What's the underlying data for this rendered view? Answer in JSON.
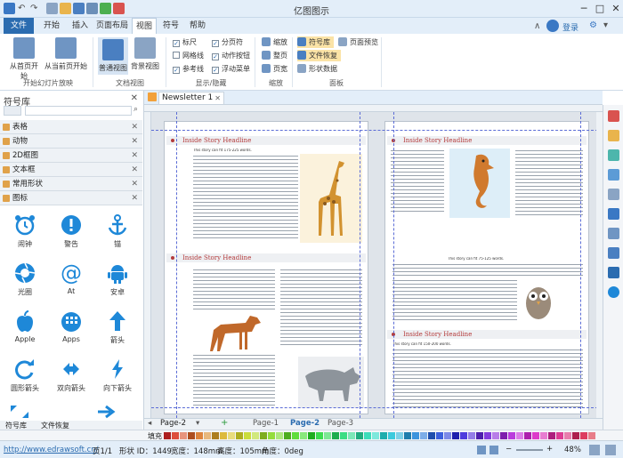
{
  "app_title": "亿图图示",
  "tabs": [
    "文件",
    "开始",
    "插入",
    "页面布局",
    "视图",
    "符号",
    "帮助"
  ],
  "active_tab": "视图",
  "top_right": {
    "login": "登录"
  },
  "ribbon": {
    "slideshow": {
      "from_start": "从首页开始",
      "from_current": "从当前页开始",
      "group": "开始幻灯片放映"
    },
    "docview": {
      "normal": "普通视图",
      "background": "背景视图",
      "group": "文档视图"
    },
    "show": {
      "ruler": "标尺",
      "pagebreak": "分页符",
      "grid": "网格线",
      "action": "动作按钮",
      "refline": "参考线",
      "float": "浮动菜单",
      "group": "显示/隐藏"
    },
    "zoom": {
      "zoom": "缩放",
      "page": "整页",
      "width": "页宽",
      "group": "缩放"
    },
    "panels": {
      "library": "符号库",
      "preview": "页面预览",
      "recover": "文件恢复",
      "shapedata": "形状数据",
      "group": "面板"
    }
  },
  "left_panel": {
    "title": "符号库",
    "categories": [
      "表格",
      "动物",
      "2D框图",
      "文本框",
      "常用形状",
      "图标"
    ],
    "shapes": [
      {
        "label": "闹钟",
        "icon": "alarm-clock-icon"
      },
      {
        "label": "警告",
        "icon": "warning-icon"
      },
      {
        "label": "锚",
        "icon": "anchor-icon"
      },
      {
        "label": "光圈",
        "icon": "aperture-icon"
      },
      {
        "label": "At",
        "icon": "at-sign-icon"
      },
      {
        "label": "安卓",
        "icon": "android-icon"
      },
      {
        "label": "Apple",
        "icon": "apple-icon"
      },
      {
        "label": "Apps",
        "icon": "apps-icon"
      },
      {
        "label": "箭头",
        "icon": "arrow-up-icon"
      },
      {
        "label": "圆形箭头",
        "icon": "circular-arrow-icon"
      },
      {
        "label": "双向箭头",
        "icon": "double-arrow-icon"
      },
      {
        "label": "向下箭头",
        "icon": "arrow-down-icon"
      }
    ],
    "bottom_tabs": [
      "符号库",
      "文件恢复"
    ]
  },
  "doc_tab": "Newsletter 1",
  "newsletter": {
    "headline": "Inside Story Headline",
    "subhead": "This story can fit 175-225 words.",
    "subhead2": "This story can fit 75-125 words.",
    "subhead3": "This story can fit 150-200 words."
  },
  "page_tabs": {
    "left": "Page-2",
    "tabs": [
      "Page-1",
      "Page-2",
      "Page-3"
    ],
    "active": "Page-2"
  },
  "palette_label": "填充",
  "status": {
    "url": "http://www.edrawsoft.cn/",
    "page": "页1/1",
    "shape_id": "形状 ID：1449",
    "width": "宽度：148mm",
    "height": "高度：105mm",
    "angle": "角度：0deg",
    "zoom": "48%"
  },
  "colors": {
    "accent": "#2b6cb0",
    "headline": "#b43b3b",
    "ribbon_bg": "#e3eef9"
  }
}
